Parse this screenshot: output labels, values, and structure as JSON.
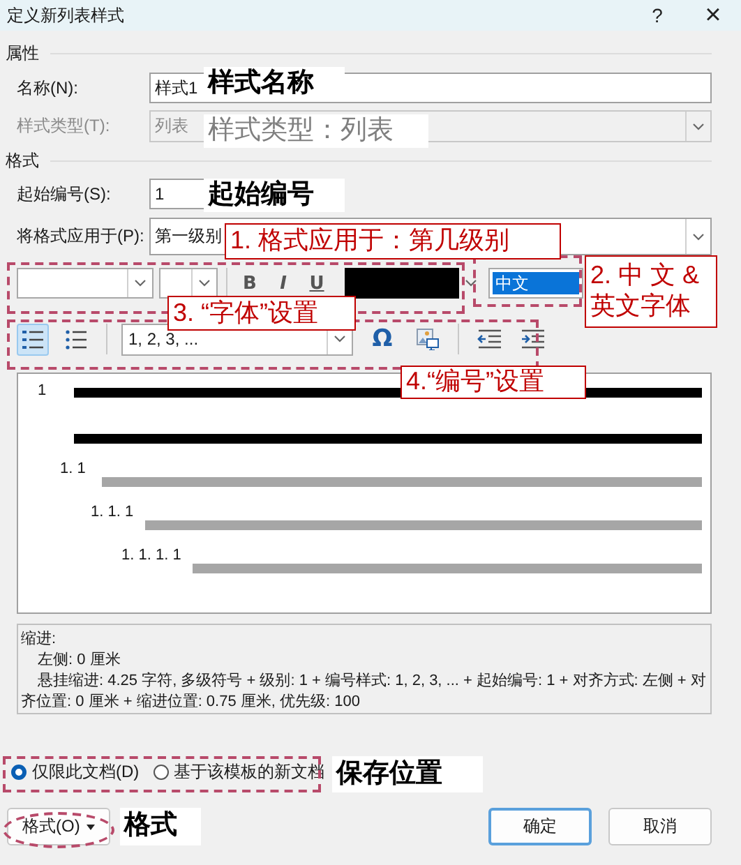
{
  "window": {
    "title": "定义新列表样式",
    "help": "?",
    "close": "×"
  },
  "properties": {
    "heading": "属性",
    "name": {
      "label": "名称(N):",
      "value": "样式1"
    },
    "style_type": {
      "label": "样式类型(T):",
      "value": "列表",
      "disabled": true
    }
  },
  "format": {
    "heading": "格式",
    "start_at": {
      "label": "起始编号(S):",
      "value": "1"
    },
    "apply_to": {
      "label": "将格式应用于(P):",
      "value": "第一级别"
    }
  },
  "font_toolbar": {
    "styles": [
      {
        "text": "B",
        "kind": "bold"
      },
      {
        "text": "I",
        "kind": "italic"
      },
      {
        "text": "U",
        "kind": "underline"
      }
    ],
    "script": "中文"
  },
  "numbering_toolbar": {
    "list_types": [
      {
        "kind": "numbered",
        "selected": true
      },
      {
        "kind": "bulleted",
        "selected": false
      }
    ],
    "number_style": "1, 2, 3, ...",
    "symbol": "Ω"
  },
  "preview": {
    "levels": [
      {
        "number": "1",
        "selected": true
      },
      {
        "number": "1. 1",
        "selected": false
      },
      {
        "number": "1. 1. 1",
        "selected": false
      },
      {
        "number": "1. 1. 1. 1",
        "selected": false
      }
    ]
  },
  "description": {
    "heading": "缩进:",
    "lines": [
      "左侧:  0 厘米",
      "悬挂缩进: 4.25 字符, 多级符号 + 级别: 1 + 编号样式: 1, 2, 3, ... + 起始编号: 1 + 对齐方式: 左侧 + 对齐位置:  0 厘米 + 缩进位置:  0.75 厘米, 优先级: 100"
    ]
  },
  "save_location": [
    {
      "label": "仅限此文档(D)",
      "selected": true
    },
    {
      "label": "基于该模板的新文档",
      "selected": false
    }
  ],
  "buttons": {
    "format": "格式(O)",
    "ok": "确定",
    "cancel": "取消"
  },
  "annotations": [
    {
      "kind": "plain",
      "text": "样式名称"
    },
    {
      "kind": "muted",
      "text": "样式类型：列表"
    },
    {
      "kind": "plain",
      "text": "起始编号"
    },
    {
      "kind": "boxed",
      "text": "1. 格式应用于：第几级别"
    },
    {
      "kind": "boxed",
      "text": "3. “字体”设置"
    },
    {
      "kind": "boxed",
      "text": "2. 中 文 &\n英文字体"
    },
    {
      "kind": "boxed",
      "text": "4.“编号”设置"
    },
    {
      "kind": "plain",
      "text": "保存位置"
    },
    {
      "kind": "plain",
      "text": "格式"
    }
  ]
}
